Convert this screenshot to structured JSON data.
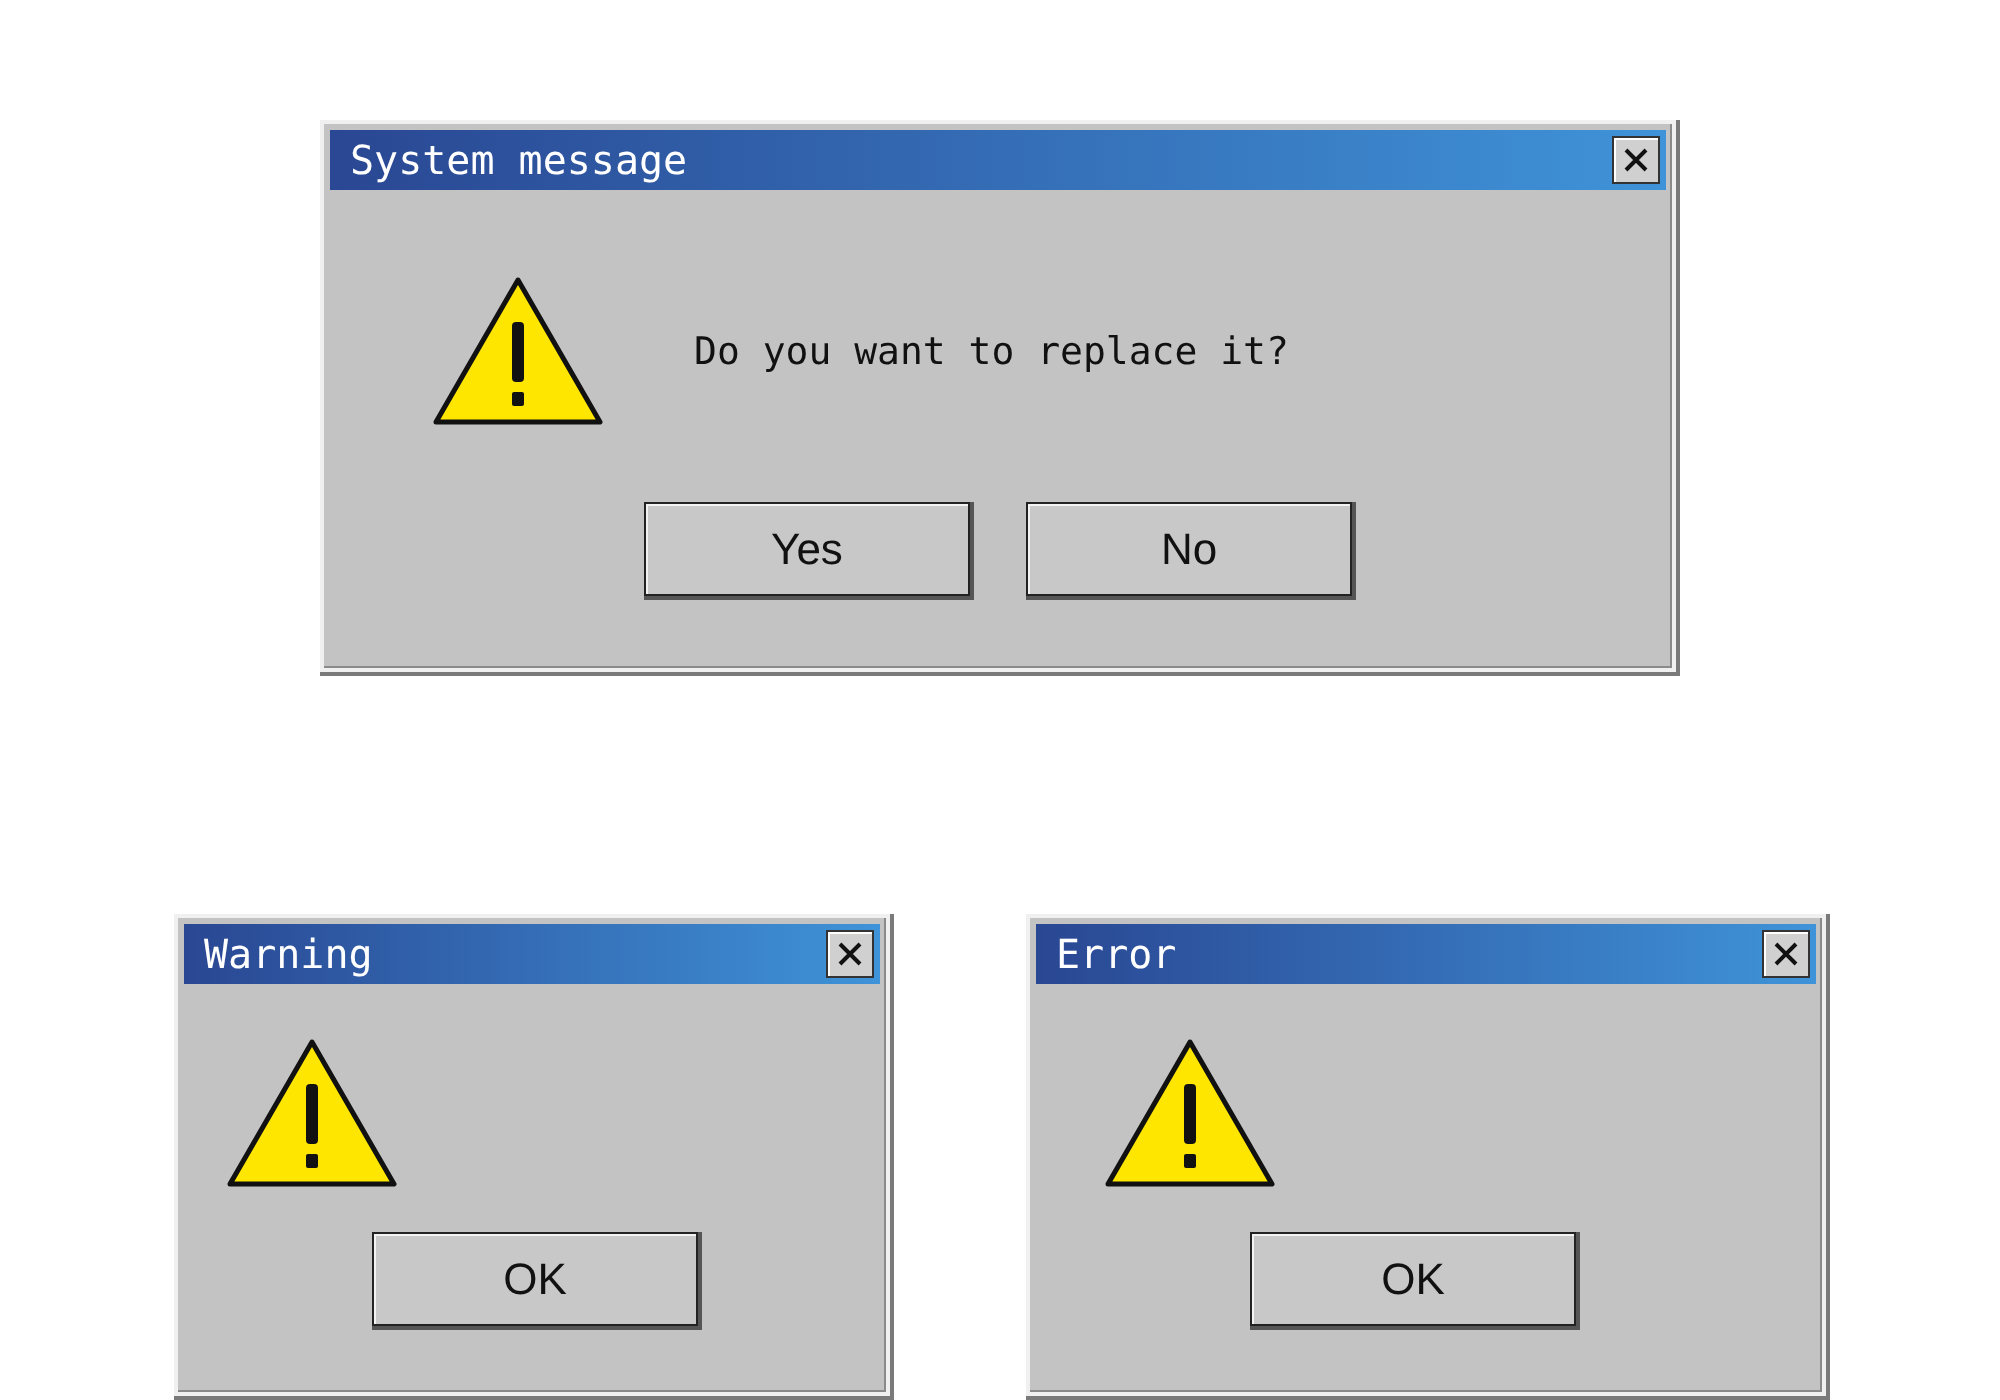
{
  "dialogs": [
    {
      "title": "System message",
      "message": "Do you want to replace it?",
      "buttons": [
        "Yes",
        "No"
      ]
    },
    {
      "title": "Warning",
      "buttons": [
        "OK"
      ]
    },
    {
      "title": "Error",
      "buttons": [
        "OK"
      ]
    }
  ]
}
